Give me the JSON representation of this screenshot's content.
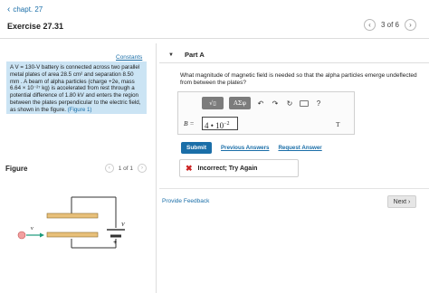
{
  "nav": {
    "back_label": "chapt. 27",
    "back_icon": "chevron-left-icon"
  },
  "exercise": {
    "title": "Exercise 27.31",
    "pager_text": "3 of 6"
  },
  "left": {
    "constants_link": "Constants",
    "problem": {
      "line1": "A V = 130-V battery is connected across two parallel",
      "line2": "metal plates of area 28.5 cm² and separation 8.50",
      "line3": "mm . A beam of alpha particles (charge +2e, mass",
      "line4": "6.64 × 10⁻²⁷ kg) is accelerated from rest through a",
      "line5": "potential difference of 1.80 kV and enters the region",
      "line6": "between the plates perpendicular to the electric field,",
      "line7_prefix": "as shown in the figure.",
      "figure_link": "(Figure 1)"
    },
    "figure": {
      "label": "Figure",
      "pager_text": "1 of 1",
      "v_label_left": "v",
      "v_label_battery": "V",
      "plus_sign": "+"
    }
  },
  "part": {
    "title": "Part A",
    "question": "What magnitude of magnetic field is needed so that the alpha particles emerge undeflected from between the plates?",
    "toolbar": {
      "templates_label": "√▯",
      "symbols_label": "ΑΣφ",
      "help_label": "?"
    },
    "answer": {
      "var_label": "B =",
      "value_base": "4 • 10",
      "value_exp": "−2",
      "units": "T"
    },
    "submit_label": "Submit",
    "previous_answers": "Previous Answers",
    "request_answer": "Request Answer",
    "feedback_text": "Incorrect; Try Again",
    "provide_feedback": "Provide Feedback",
    "next_label": "Next"
  },
  "colors": {
    "accent": "#1a6ea8",
    "problem_bg": "#cbe4f4",
    "error": "#cc2222",
    "plate": "#e8c07a"
  }
}
